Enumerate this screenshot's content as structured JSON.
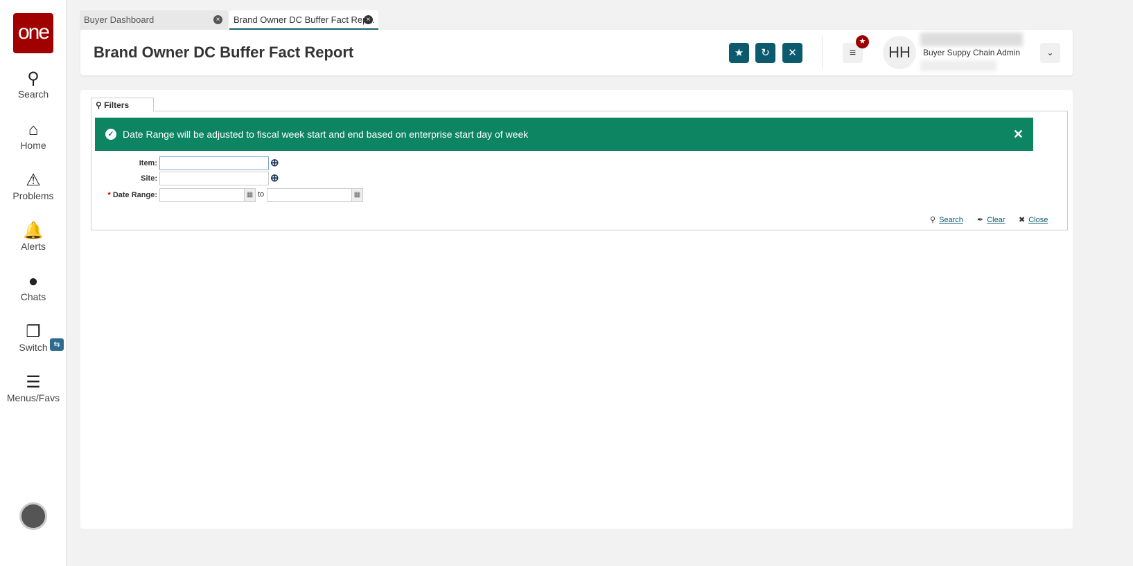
{
  "sidebar": {
    "logo": "one",
    "items": [
      {
        "label": "Search"
      },
      {
        "label": "Home"
      },
      {
        "label": "Problems"
      },
      {
        "label": "Alerts"
      },
      {
        "label": "Chats"
      },
      {
        "label": "Switch"
      },
      {
        "label": "Menus/Favs"
      }
    ]
  },
  "tabs": [
    {
      "label": "Buyer Dashboard"
    },
    {
      "label": "Brand Owner DC Buffer Fact Rep..."
    }
  ],
  "header": {
    "title": "Brand Owner DC Buffer Fact Report",
    "user_initials": "HH",
    "user_role": "Buyer Suppy Chain Admin"
  },
  "filters": {
    "tab_label": "Filters",
    "banner": "Date Range will be adjusted to fiscal week start and end based on enterprise start day of week",
    "item_label": "Item:",
    "site_label": "Site:",
    "date_label": "Date Range:",
    "required_mark": "*",
    "to_label": "to",
    "item_value": "",
    "site_value": "",
    "date_from": "",
    "date_to": "",
    "search": "Search",
    "clear": "Clear",
    "close": "Close"
  },
  "colors": {
    "brand": "#a00000",
    "accent": "#0b5a6e",
    "banner": "#0d8462"
  }
}
